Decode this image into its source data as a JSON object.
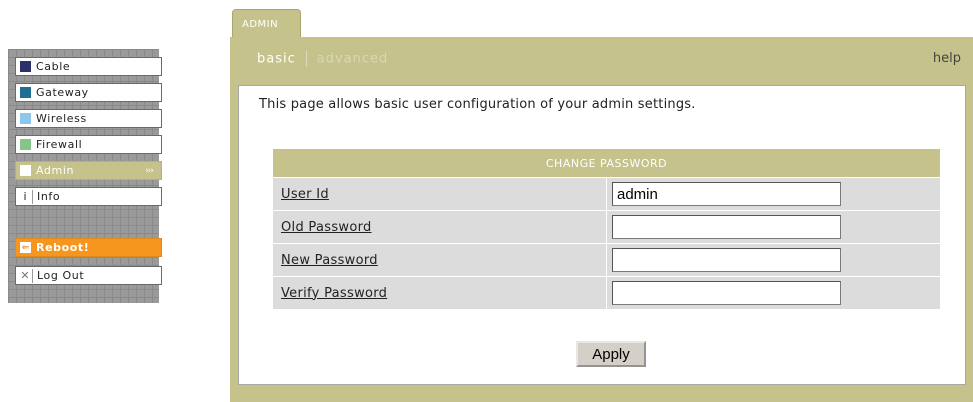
{
  "sidebar": {
    "items": [
      {
        "label": "Cable",
        "color": "#2b2f6b",
        "icon": "cable-color-swatch-icon"
      },
      {
        "label": "Gateway",
        "color": "#1f6e96",
        "icon": "gateway-color-swatch-icon"
      },
      {
        "label": "Wireless",
        "color": "#8ec6ec",
        "icon": "wireless-color-swatch-icon"
      },
      {
        "label": "Firewall",
        "color": "#86c48a",
        "icon": "firewall-color-swatch-icon"
      },
      {
        "label": "Admin",
        "color": "#ffffff",
        "icon": "admin-color-swatch-icon",
        "active": true,
        "arrow": "›››"
      },
      {
        "label": "Info",
        "icon": "info-icon",
        "glyph": "i"
      }
    ],
    "reboot": {
      "label": "Reboot!",
      "icon": "reboot-arrow-icon",
      "glyph": "⇐",
      "color": "#f6961e"
    },
    "logout": {
      "label": "Log Out",
      "icon": "close-icon",
      "glyph": "✕"
    }
  },
  "tab": {
    "label": "ADMIN"
  },
  "subnav": {
    "basic": "basic",
    "advanced": "advanced",
    "help": "help"
  },
  "main": {
    "intro": "This page allows basic user configuration of your admin settings.",
    "form": {
      "header": "CHANGE PASSWORD",
      "fields": [
        {
          "label": "User Id",
          "value": "admin"
        },
        {
          "label": "Old Password",
          "value": ""
        },
        {
          "label": "New Password",
          "value": ""
        },
        {
          "label": "Verify Password",
          "value": ""
        }
      ],
      "apply_label": "Apply"
    }
  },
  "colors": {
    "accent": "#c5c28b",
    "reboot": "#f6961e"
  }
}
